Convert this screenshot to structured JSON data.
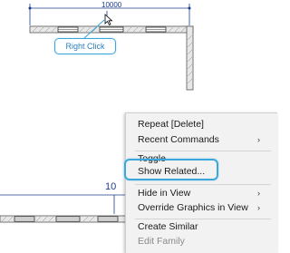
{
  "top_view": {
    "dimension_label": "10000",
    "callout_label": "Right Click"
  },
  "bottom_view": {
    "dimension_label": "10"
  },
  "context_menu": {
    "items": [
      {
        "label": "Repeat [Delete]",
        "submenu": false,
        "enabled": true
      },
      {
        "label": "Recent Commands",
        "submenu": true,
        "enabled": true
      },
      {
        "label": "Toggle",
        "submenu": false,
        "enabled": true
      },
      {
        "label": "Show Related...",
        "submenu": false,
        "enabled": true,
        "highlighted": true
      },
      {
        "label": "Hide in View",
        "submenu": true,
        "enabled": true
      },
      {
        "label": "Override Graphics in View",
        "submenu": true,
        "enabled": true
      },
      {
        "label": "Create Similar",
        "submenu": false,
        "enabled": true
      },
      {
        "label": "Edit Family",
        "submenu": false,
        "enabled": false
      }
    ],
    "submenu_arrow": "›"
  },
  "colors": {
    "highlight": "#3aa7dc",
    "dimension": "#1b3c8c"
  }
}
